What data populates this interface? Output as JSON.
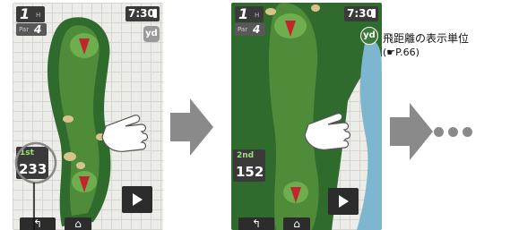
{
  "screens": [
    {
      "hole_number": "1",
      "hole_suffix": "H",
      "par_label": "Par",
      "par_value": "4",
      "time": "7:30",
      "unit_icon": "yd",
      "shot_label": "1st",
      "distance": "233"
    },
    {
      "hole_number": "1",
      "hole_suffix": "H",
      "par_label": "Par",
      "par_value": "4",
      "time": "7:30",
      "unit_icon": "yd",
      "shot_label": "2nd",
      "distance": "152"
    }
  ],
  "callout": {
    "title": "飛距離の表示単位",
    "reference": "(☛P.66)"
  },
  "icons": {
    "play": "play-triangle-icon",
    "back": "back-arrow-icon",
    "home": "home-icon",
    "hand": "pointing-hand-icon",
    "flag": "pin-flag-icon",
    "next": "right-arrow-icon",
    "more": "ellipsis-dots-icon"
  },
  "colors": {
    "fairway": "#4e8c3a",
    "rough": "#2f6b2c",
    "water": "#7fb6cf",
    "bunker": "#d8c48a",
    "arrow": "#8a8a8a",
    "callout_circle": "#888888"
  }
}
